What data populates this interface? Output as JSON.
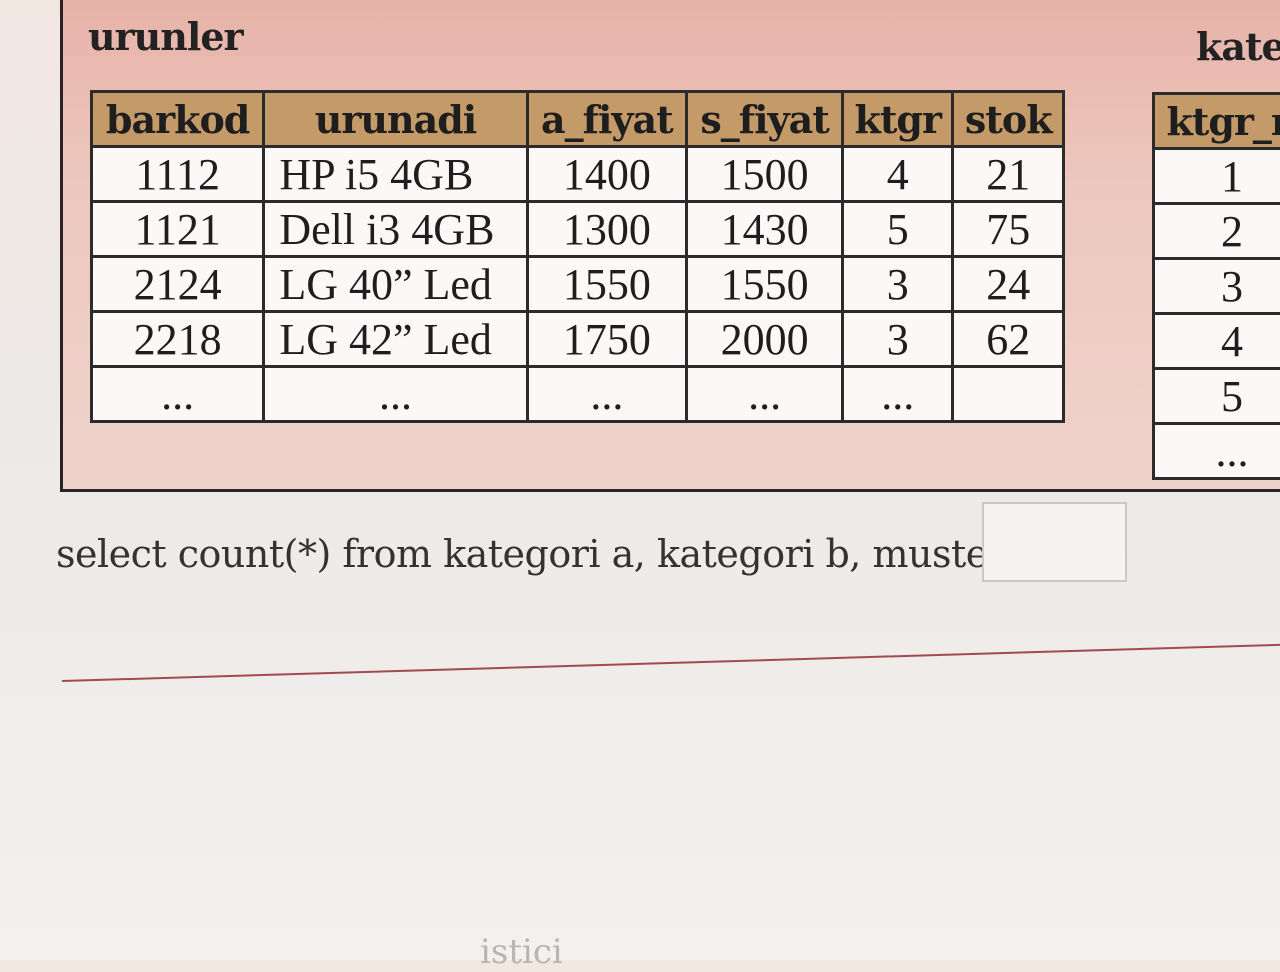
{
  "urunler": {
    "title": "urunler",
    "columns": [
      "barkod",
      "urunadi",
      "a_fiyat",
      "s_fiyat",
      "ktgr",
      "stok"
    ],
    "rows": [
      [
        "1112",
        "HP i5 4GB",
        "1400",
        "1500",
        "4",
        "21"
      ],
      [
        "1121",
        "Dell i3 4GB",
        "1300",
        "1430",
        "5",
        "75"
      ],
      [
        "2124",
        "LG 40” Led",
        "1550",
        "1550",
        "3",
        "24"
      ],
      [
        "2218",
        "LG 42” Led",
        "1750",
        "2000",
        "3",
        "62"
      ],
      [
        "...",
        "...",
        "...",
        "...",
        "...",
        ""
      ]
    ]
  },
  "kategori": {
    "title": "kateg",
    "column": "ktgr_n",
    "rows": [
      "1",
      "2",
      "3",
      "4",
      "5",
      "..."
    ]
  },
  "question": {
    "text": "select count(*) from kategori a, kategori b, musteri c",
    "answer_value": ""
  },
  "footer": {
    "partial_text": "istici"
  },
  "colors": {
    "panel_bg": "#edc8be",
    "header_bg": "#c49a68",
    "divider": "#a24a52"
  }
}
